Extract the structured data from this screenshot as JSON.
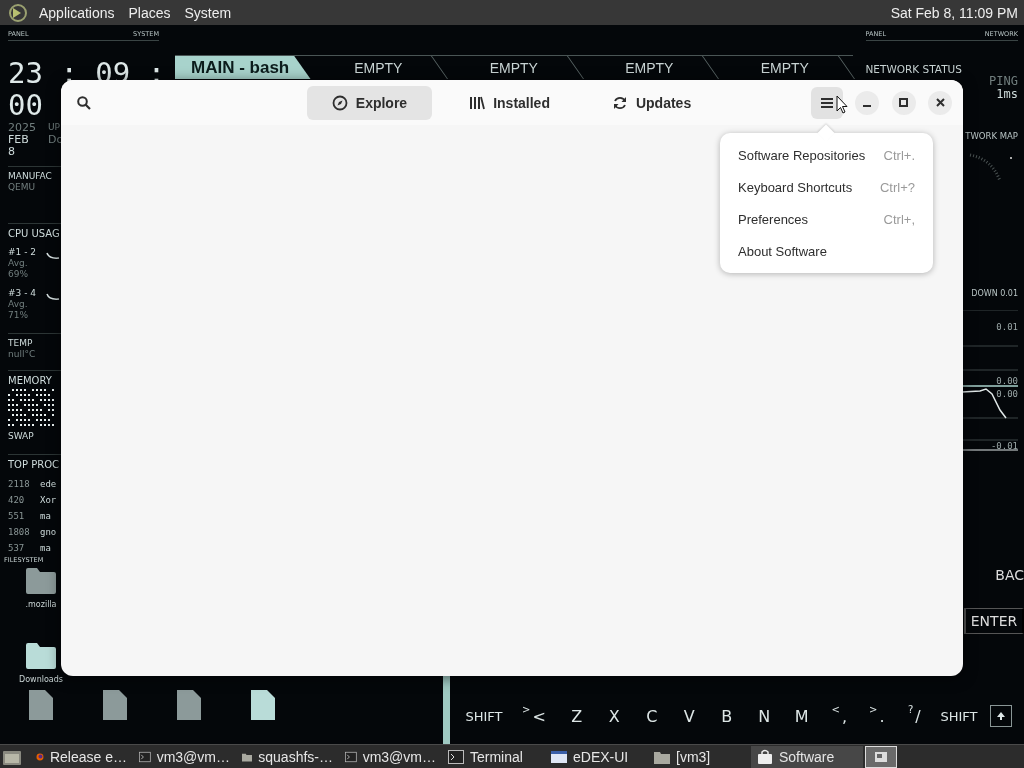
{
  "top_panel": {
    "menus": [
      "Applications",
      "Places",
      "System"
    ],
    "clock": "Sat Feb  8, 11:09 PM"
  },
  "left_panel": {
    "header": [
      "PANEL",
      "SYSTEM"
    ],
    "time": [
      "23 : 09 :",
      "00"
    ],
    "year": "2025",
    "month": "FEB",
    "day": "8",
    "uptime_label": "UP",
    "fragment": "Do",
    "manufacturer_label": "MANUFAC",
    "manufacturer": "QEMU",
    "cpu_title": "CPU USAG",
    "cpu_groups": [
      {
        "name": "#1 - 2",
        "avg_label": "Avg.",
        "avg": "69%"
      },
      {
        "name": "#3 - 4",
        "avg_label": "Avg.",
        "avg": "71%"
      }
    ],
    "temp_label": "TEMP",
    "temp": "null°C",
    "memory_title": "MEMORY",
    "swap_label": "SWAP",
    "processes_title": "TOP PROC",
    "processes": [
      {
        "pid": "2118",
        "name": "ede"
      },
      {
        "pid": "420",
        "name": "Xor"
      },
      {
        "pid": "551",
        "name": "ma"
      },
      {
        "pid": "1808",
        "name": "gno"
      },
      {
        "pid": "537",
        "name": "ma"
      }
    ]
  },
  "filesystem": {
    "title": "FILESYSTEM",
    "rows": [
      {
        "items": [
          {
            "kind": "folder",
            "name": ".mozilla",
            "highlighted": false
          }
        ]
      },
      {
        "items": [
          {
            "kind": "folder",
            "name": "Downloads",
            "highlighted": true
          }
        ]
      },
      {
        "items": [
          {
            "kind": "file",
            "highlighted": false
          },
          {
            "kind": "file",
            "highlighted": false
          },
          {
            "kind": "file",
            "highlighted": false
          },
          {
            "kind": "file",
            "highlighted": true
          }
        ]
      }
    ]
  },
  "terminal_tabs": [
    {
      "label": "MAIN - bash",
      "selected": true
    },
    {
      "label": "EMPTY",
      "selected": false
    },
    {
      "label": "EMPTY",
      "selected": false
    },
    {
      "label": "EMPTY",
      "selected": false
    },
    {
      "label": "EMPTY",
      "selected": false
    }
  ],
  "right_panel": {
    "header": [
      "PANEL",
      "NETWORK"
    ],
    "status_title": "NETWORK STATUS",
    "ping_label": "PING",
    "ping": "1ms",
    "map_title": "TWORK MAP",
    "traffic_label": "DOWN 0.01",
    "graph_labels": [
      "0.01",
      "0.00",
      "0.00",
      "-0.01"
    ]
  },
  "keyboard": {
    "side_keys": [
      "BAC",
      "ENTER"
    ],
    "bottom_row": [
      {
        "kind": "wide",
        "label": "SHIFT"
      },
      {
        "kind": "dual",
        "top": ">",
        "label": "<"
      },
      {
        "kind": "letter",
        "label": "Z"
      },
      {
        "kind": "letter",
        "label": "X"
      },
      {
        "kind": "letter",
        "label": "C"
      },
      {
        "kind": "letter",
        "label": "V"
      },
      {
        "kind": "letter",
        "label": "B"
      },
      {
        "kind": "letter",
        "label": "N"
      },
      {
        "kind": "letter",
        "label": "M"
      },
      {
        "kind": "dual",
        "top": "<",
        "label": ","
      },
      {
        "kind": "dual",
        "top": ">",
        "label": "."
      },
      {
        "kind": "dual",
        "top": "?",
        "label": "/"
      },
      {
        "kind": "wide",
        "label": "SHIFT"
      },
      {
        "kind": "arrow"
      }
    ]
  },
  "software_window": {
    "view_tabs": [
      {
        "label": "Explore",
        "selected": true
      },
      {
        "label": "Installed",
        "selected": false
      },
      {
        "label": "Updates",
        "selected": false
      }
    ],
    "menu": {
      "open": true,
      "items": [
        {
          "label": "Software Repositories",
          "shortcut": "Ctrl+."
        },
        {
          "label": "Keyboard Shortcuts",
          "shortcut": "Ctrl+?"
        },
        {
          "label": "Preferences",
          "shortcut": "Ctrl+,"
        },
        {
          "label": "About Software"
        }
      ]
    }
  },
  "taskbar": {
    "items": [
      {
        "kind": "browser",
        "label": "Release e…",
        "selected": false
      },
      {
        "kind": "terminal",
        "label": "vm3@vm…",
        "selected": false
      },
      {
        "kind": "folder",
        "label": "squashfs-…",
        "selected": false
      },
      {
        "kind": "terminal",
        "label": "vm3@vm…",
        "selected": false
      },
      {
        "kind": "terminal",
        "label": "Terminal",
        "selected": false
      },
      {
        "kind": "window",
        "label": "eDEX-UI",
        "selected": false
      },
      {
        "kind": "folder",
        "label": "[vm3]",
        "selected": false
      },
      {
        "kind": "store",
        "label": "Software",
        "selected": true
      }
    ]
  }
}
